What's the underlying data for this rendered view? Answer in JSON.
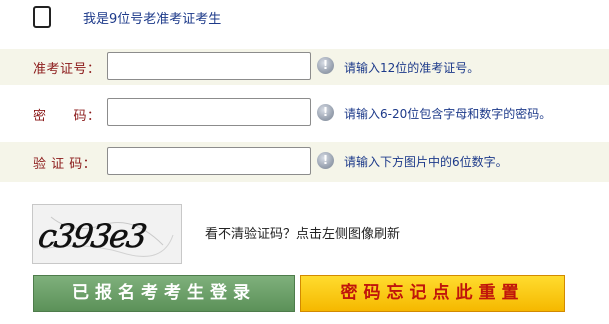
{
  "old_candidate": {
    "label": "我是9位号老准考证考生",
    "checked": false
  },
  "form": {
    "ticket": {
      "label": "准考证号：",
      "value": "",
      "hint": "请输入12位的准考证号。"
    },
    "password": {
      "label": "密　　码：",
      "value": "",
      "hint": "请输入6-20位包含字母和数字的密码。"
    },
    "captcha_code": {
      "label": "验 证 码：",
      "value": "",
      "hint": "请输入下方图片中的6位数字。"
    }
  },
  "captcha": {
    "image_text": "c393e3",
    "refresh_text": "看不清验证码？点击左侧图像刷新"
  },
  "info_icon_glyph": "!",
  "buttons": {
    "login": "已报名考考生登录",
    "reset_password": "密码忘记点此重置"
  },
  "colors": {
    "label_red": "#8b1a1a",
    "hint_blue": "#1d3a8a",
    "row_shade": "#f5f5e9",
    "login_green": "#5c9159",
    "reset_yellow": "#f5b800",
    "reset_text_red": "#c0150b"
  }
}
